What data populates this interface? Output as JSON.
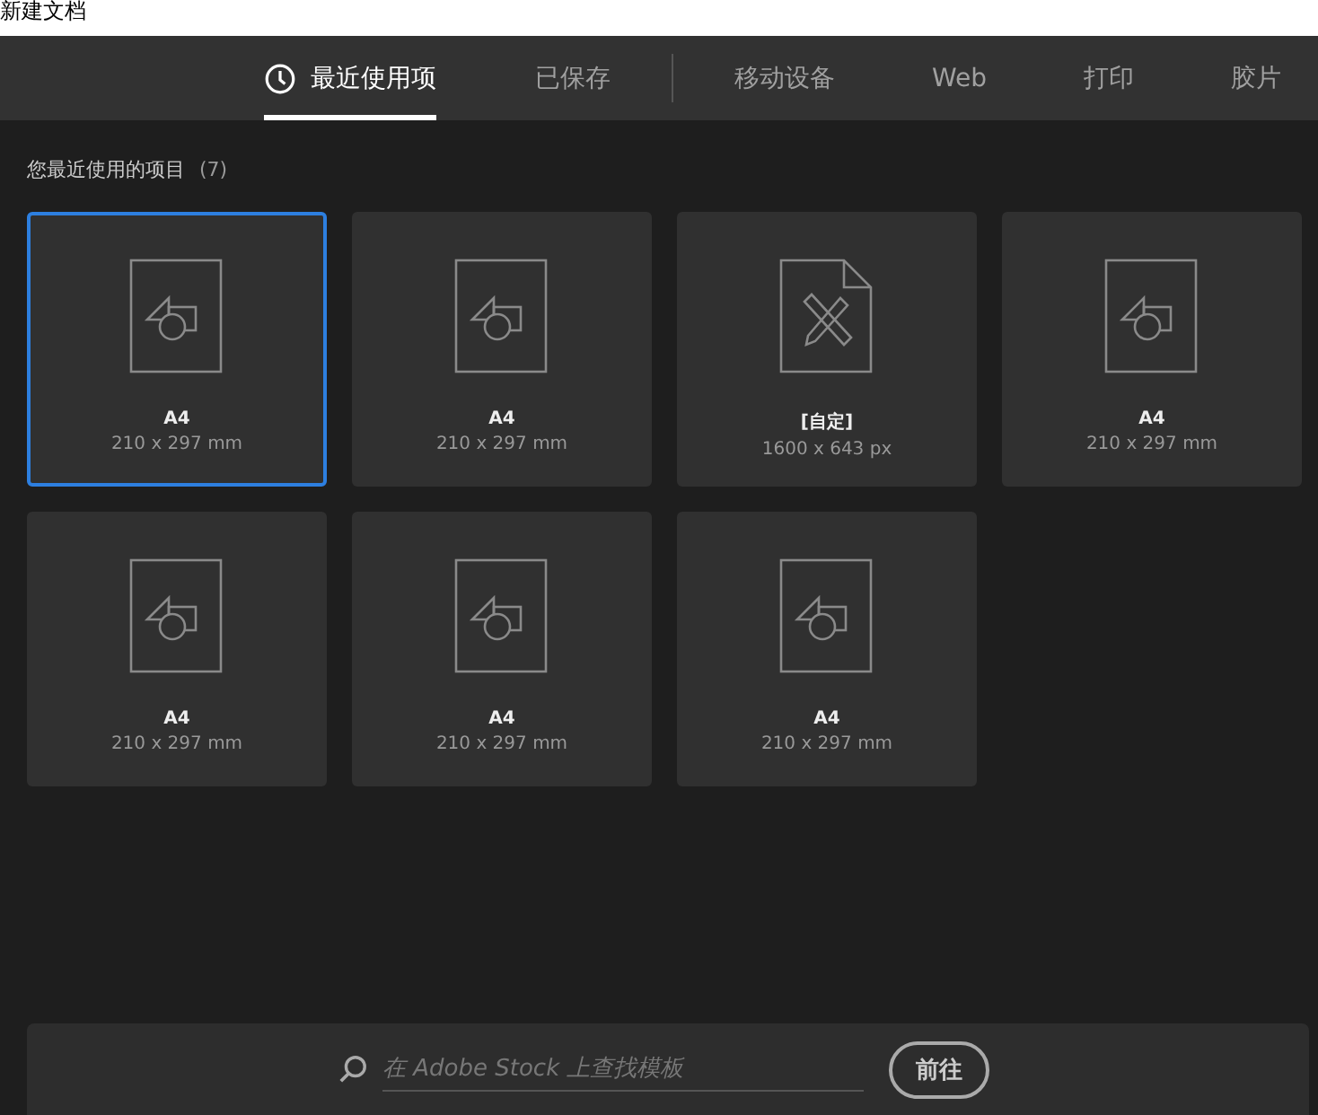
{
  "window": {
    "title": "新建文档"
  },
  "tabs": [
    {
      "label": "最近使用项",
      "selected": true
    },
    {
      "label": "已保存",
      "selected": false
    },
    {
      "label": "移动设备",
      "selected": false
    },
    {
      "label": "Web",
      "selected": false
    },
    {
      "label": "打印",
      "selected": false
    },
    {
      "label": "胶片",
      "selected": false
    }
  ],
  "section": {
    "title": "您最近使用的项目",
    "count": "(7)"
  },
  "presets": [
    {
      "kind": "doc",
      "name": "A4",
      "size": "210 x 297 mm",
      "selected": true
    },
    {
      "kind": "doc",
      "name": "A4",
      "size": "210 x 297 mm",
      "selected": false
    },
    {
      "kind": "custom",
      "name": "[自定]",
      "size": "1600 x 643 px",
      "selected": false
    },
    {
      "kind": "doc",
      "name": "A4",
      "size": "210 x 297 mm",
      "selected": false
    },
    {
      "kind": "doc",
      "name": "A4",
      "size": "210 x 297 mm",
      "selected": false
    },
    {
      "kind": "doc",
      "name": "A4",
      "size": "210 x 297 mm",
      "selected": false
    },
    {
      "kind": "doc",
      "name": "A4",
      "size": "210 x 297 mm",
      "selected": false
    }
  ],
  "stock_search": {
    "placeholder": "在 Adobe Stock 上查找模板",
    "button": "前往"
  }
}
